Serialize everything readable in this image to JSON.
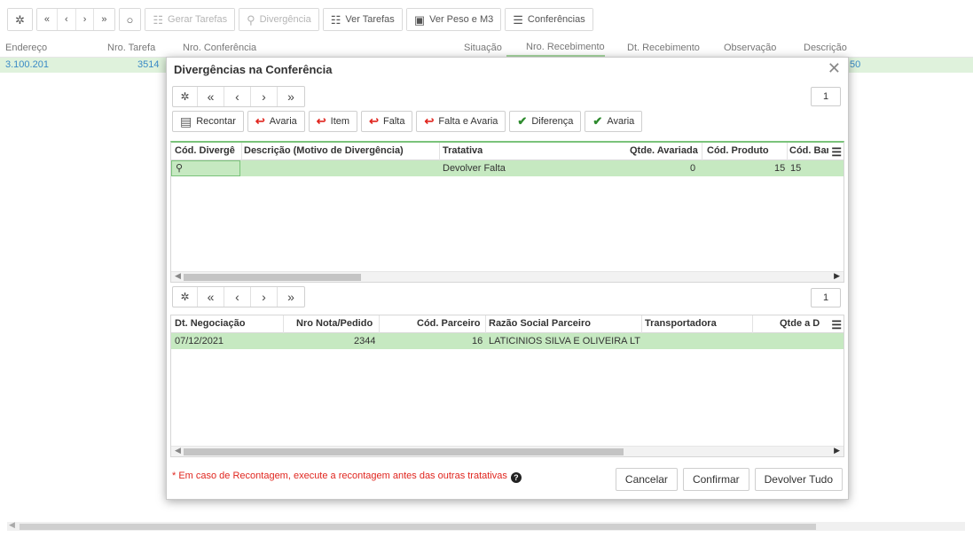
{
  "background": {
    "toolbar": {
      "gear_icon": "gear-icon",
      "nav": [
        "«",
        "‹",
        "›",
        "»"
      ],
      "refresh_icon": "refresh-icon",
      "gerar_tarefas": "Gerar Tarefas",
      "divergencia": "Divergência",
      "ver_tarefas": "Ver Tarefas",
      "ver_peso": "Ver Peso e M3",
      "conferencias": "Conferências"
    },
    "columns": {
      "endereco": "Endereço",
      "nro_tarefa": "Nro. Tarefa",
      "nro_conferencia": "Nro. Conferência",
      "situacao": "Situação",
      "nro_recebimento": "Nro. Recebimento",
      "dt_recebimento": "Dt. Recebimento",
      "observacao": "Observação",
      "descricao": "Descrição"
    },
    "row": {
      "endereco": "3.100.201",
      "nro_tarefa": "3514",
      "descricao_tail": "50"
    }
  },
  "modal": {
    "title": "Divergências na Conferência",
    "top_nav": {
      "page": "1"
    },
    "actions": {
      "recontar": "Recontar",
      "avaria": "Avaria",
      "item": "Item",
      "falta": "Falta",
      "falta_avaria": "Falta e Avaria",
      "diferenca": "Diferença",
      "avaria_ok": "Avaria"
    },
    "top_grid": {
      "headers": {
        "cod_divergencia": "Cód. Divergê",
        "descricao": "Descrição (Motivo de Divergência)",
        "tratativa": "Tratativa",
        "qtde_avariada": "Qtde. Avariada",
        "cod_produto": "Cód. Produto",
        "cod_barras": "Cód. Bar"
      },
      "row": {
        "tratativa": "Devolver Falta",
        "qtde_avariada": "0",
        "cod_produto": "15",
        "cod_barras": "15"
      }
    },
    "bottom_nav": {
      "page": "1"
    },
    "bottom_grid": {
      "headers": {
        "dt_negociacao": "Dt. Negociação",
        "nro_nota": "Nro Nota/Pedido",
        "cod_parceiro": "Cód. Parceiro",
        "razao_social": "Razão Social Parceiro",
        "transportadora": "Transportadora",
        "qtde": "Qtde a D"
      },
      "row": {
        "dt_negociacao": "07/12/2021",
        "nro_nota": "2344",
        "cod_parceiro": "16",
        "razao_social": "LATICINIOS SILVA E OLIVEIRA LT"
      }
    },
    "footer": {
      "note": "* Em caso de Recontagem, execute a recontagem antes das outras tratativas",
      "cancelar": "Cancelar",
      "confirmar": "Confirmar",
      "devolver_tudo": "Devolver Tudo"
    }
  }
}
